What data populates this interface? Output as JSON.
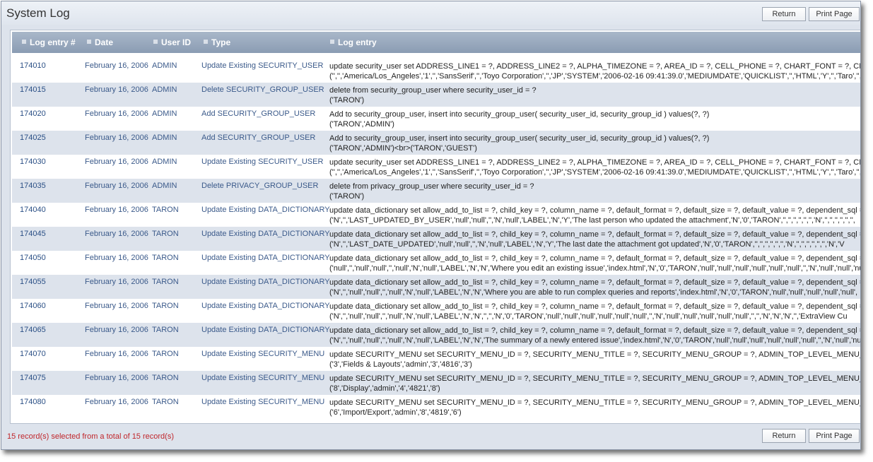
{
  "page": {
    "title": "System Log",
    "return_label": "Return",
    "print_label": "Print Page",
    "footer_status": "15 record(s) selected from a total of 15 record(s)"
  },
  "columns": [
    "Log entry #",
    "Date",
    "User ID",
    "Type",
    "Log entry"
  ],
  "rows": [
    {
      "id": "174010",
      "date": "February 16, 2006",
      "user": "ADMIN",
      "type": "Update Existing SECURITY_USER",
      "line1": "update security_user set ADDRESS_LINE1 = ?, ADDRESS_LINE2 = ?, ALPHA_TIMEZONE = ?, AREA_ID = ?, CELL_PHONE = ?, CHART_FONT = ?, CITY = ?, C",
      "line2": "('','','America/Los_Angeles','1','','SansSerif','','Toyo Corporation','','JP','SYSTEM','2006-02-16 09:41:39.0','MEDIUMDATE','QUICKLIST','','HTML','Y','','Taro','','','ja',"
    },
    {
      "id": "174015",
      "date": "February 16, 2006",
      "user": "ADMIN",
      "type": "Delete SECURITY_GROUP_USER",
      "line1": "delete from security_group_user where security_user_id = ?",
      "line2": "('TARON')"
    },
    {
      "id": "174020",
      "date": "February 16, 2006",
      "user": "ADMIN",
      "type": "Add SECURITY_GROUP_USER",
      "line1": "Add to security_group_user, insert into security_group_user( security_user_id, security_group_id ) values(?, ?)",
      "line2": "('TARON','ADMIN')"
    },
    {
      "id": "174025",
      "date": "February 16, 2006",
      "user": "ADMIN",
      "type": "Add SECURITY_GROUP_USER",
      "line1": "Add to security_group_user, insert into security_group_user( security_user_id, security_group_id ) values(?, ?)",
      "line2": "('TARON','ADMIN')<br>('TARON','GUEST')"
    },
    {
      "id": "174030",
      "date": "February 16, 2006",
      "user": "ADMIN",
      "type": "Update Existing SECURITY_USER",
      "line1": "update security_user set ADDRESS_LINE1 = ?, ADDRESS_LINE2 = ?, ALPHA_TIMEZONE = ?, AREA_ID = ?, CELL_PHONE = ?, CHART_FONT = ?, CITY = ?, C",
      "line2": "('','','America/Los_Angeles','1','','SansSerif','','Toyo Corporation','','JP','SYSTEM','2006-02-16 09:41:39.0','MEDIUMDATE','QUICKLIST','','HTML','Y','','Taro','','','ja',"
    },
    {
      "id": "174035",
      "date": "February 16, 2006",
      "user": "ADMIN",
      "type": "Delete PRIVACY_GROUP_USER",
      "line1": "delete from privacy_group_user where security_user_id = ?",
      "line2": "('TARON')"
    },
    {
      "id": "174040",
      "date": "February 16, 2006",
      "user": "TARON",
      "type": "Update Existing DATA_DICTIONARY",
      "line1": "update data_dictionary set allow_add_to_list = ?, child_key = ?, column_name = ?, default_format = ?, default_size = ?, default_value = ?, dependent_sql = ?",
      "line2": "('N','','LAST_UPDATED_BY_USER','null','null','','N','null','LABEL','N','Y','The last person who updated the attachment','N','0','TARON','','','','','','','N','','','','','','',"
    },
    {
      "id": "174045",
      "date": "February 16, 2006",
      "user": "TARON",
      "type": "Update Existing DATA_DICTIONARY",
      "line1": "update data_dictionary set allow_add_to_list = ?, child_key = ?, column_name = ?, default_format = ?, default_size = ?, default_value = ?, dependent_sql = ?",
      "line2": "('N','','LAST_DATE_UPDATED','null','null','','N','null','LABEL','N','Y','The last date the attachment got updated','N','0','TARON','','','','','','','N','','','','','','','N','V"
    },
    {
      "id": "174050",
      "date": "February 16, 2006",
      "user": "TARON",
      "type": "Update Existing DATA_DICTIONARY",
      "line1": "update data_dictionary set allow_add_to_list = ?, child_key = ?, column_name = ?, default_format = ?, default_size = ?, default_value = ?, dependent_sql = ?",
      "line2": "('null','','null','null','','null','N','null','LABEL','N','N','Where you edit an existing issue','index.html','N','0','TARON','null','null','null','null','null','null','','N','null','null','nu"
    },
    {
      "id": "174055",
      "date": "February 16, 2006",
      "user": "TARON",
      "type": "Update Existing DATA_DICTIONARY",
      "line1": "update data_dictionary set allow_add_to_list = ?, child_key = ?, column_name = ?, default_format = ?, default_size = ?, default_value = ?, dependent_sql = ?",
      "line2": "('N','','null','null','','null','N','null','LABEL','N','N','Where you are able to run complex queries and reports','index.html','N','0','TARON','null','null','null','null','null',"
    },
    {
      "id": "174060",
      "date": "February 16, 2006",
      "user": "TARON",
      "type": "Update Existing DATA_DICTIONARY",
      "line1": "update data_dictionary set allow_add_to_list = ?, child_key = ?, column_name = ?, default_format = ?, default_size = ?, default_value = ?, dependent_sql = ?",
      "line2": "('N','','null','null','','null','N','null','LABEL','N','N','','','N','0','TARON','null','null','null','null','null','null','','N','null','null','null','null','null','','','N','N','N','','ExtraView Cu"
    },
    {
      "id": "174065",
      "date": "February 16, 2006",
      "user": "TARON",
      "type": "Update Existing DATA_DICTIONARY",
      "line1": "update data_dictionary set allow_add_to_list = ?, child_key = ?, column_name = ?, default_format = ?, default_size = ?, default_value = ?, dependent_sql = ?",
      "line2": "('N','','null','null','','null','N','null','LABEL','N','N','The summary of a newly entered issue','index.html','N','0','TARON','null','null','null','null','null','null','','N','null','null','nu"
    },
    {
      "id": "174070",
      "date": "February 16, 2006",
      "user": "TARON",
      "type": "Update Existing SECURITY_MENU",
      "line1": "update SECURITY_MENU set SECURITY_MENU_ID = ?, SECURITY_MENU_TITLE = ?, SECURITY_MENU_GROUP = ?, ADMIN_TOP_LEVEL_MENU_ORDER = ?, t",
      "line2": "('3','Fields & Layouts','admin','3','4816','3')"
    },
    {
      "id": "174075",
      "date": "February 16, 2006",
      "user": "TARON",
      "type": "Update Existing SECURITY_MENU",
      "line1": "update SECURITY_MENU set SECURITY_MENU_ID = ?, SECURITY_MENU_TITLE = ?, SECURITY_MENU_GROUP = ?, ADMIN_TOP_LEVEL_MENU_ORDER = ?, t",
      "line2": "('8','Display','admin','4','4821','8')"
    },
    {
      "id": "174080",
      "date": "February 16, 2006",
      "user": "TARON",
      "type": "Update Existing SECURITY_MENU",
      "line1": "update SECURITY_MENU set SECURITY_MENU_ID = ?, SECURITY_MENU_TITLE = ?, SECURITY_MENU_GROUP = ?, ADMIN_TOP_LEVEL_MENU_ORDER = ?, t",
      "line2": "('6','Import/Export','admin','8','4819','6')"
    }
  ]
}
